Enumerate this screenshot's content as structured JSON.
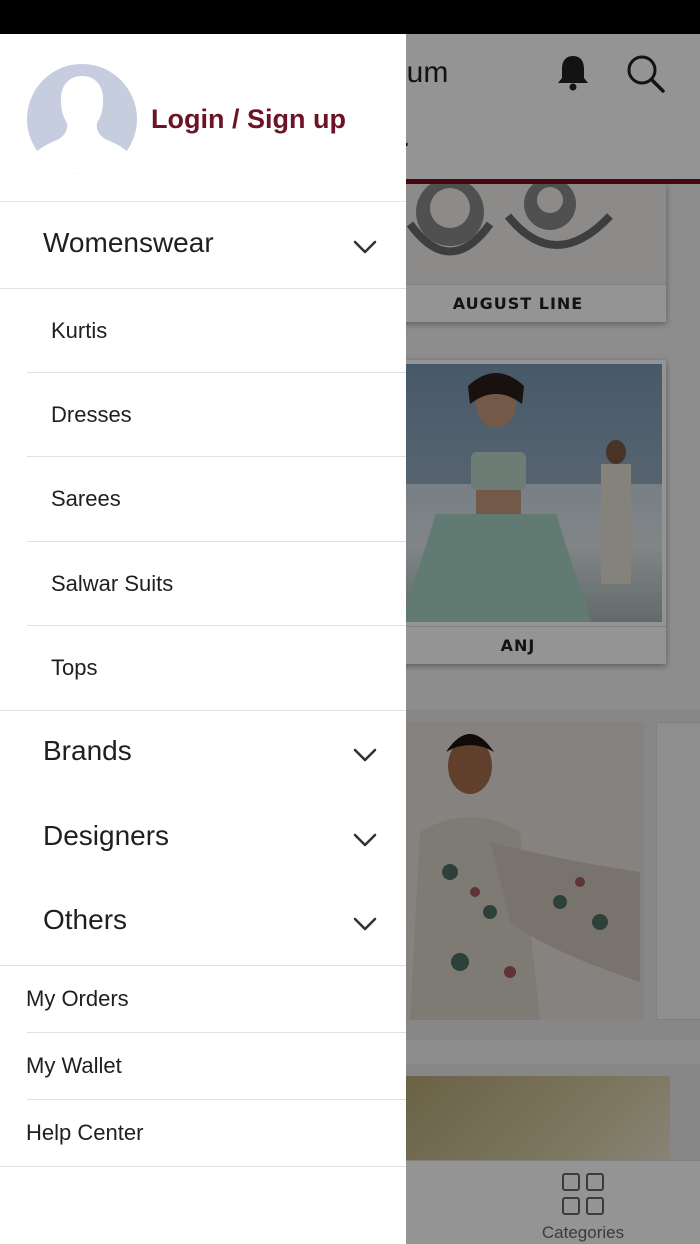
{
  "background_app": {
    "title_fragment": "ium",
    "subtitle_fragment": ".",
    "cards": [
      {
        "label": "AUGUST LINE"
      },
      {
        "label": "ANJ"
      }
    ],
    "tabbar": {
      "categories_label": "Categories"
    }
  },
  "drawer": {
    "login_label": "Login / Sign up",
    "categories": [
      {
        "label": "Womenswear",
        "expanded": true
      },
      {
        "label": "Brands",
        "expanded": false
      },
      {
        "label": "Designers",
        "expanded": false
      },
      {
        "label": "Others",
        "expanded": false
      }
    ],
    "womenswear_items": [
      {
        "label": "Kurtis"
      },
      {
        "label": "Dresses"
      },
      {
        "label": "Sarees"
      },
      {
        "label": "Salwar Suits"
      },
      {
        "label": "Tops"
      }
    ],
    "links": [
      {
        "label": "My Orders"
      },
      {
        "label": "My Wallet"
      },
      {
        "label": "Help Center"
      }
    ]
  },
  "colors": {
    "brand": "#7a0f1e",
    "login_text": "#6c1426",
    "avatar": "#c6cddf"
  }
}
